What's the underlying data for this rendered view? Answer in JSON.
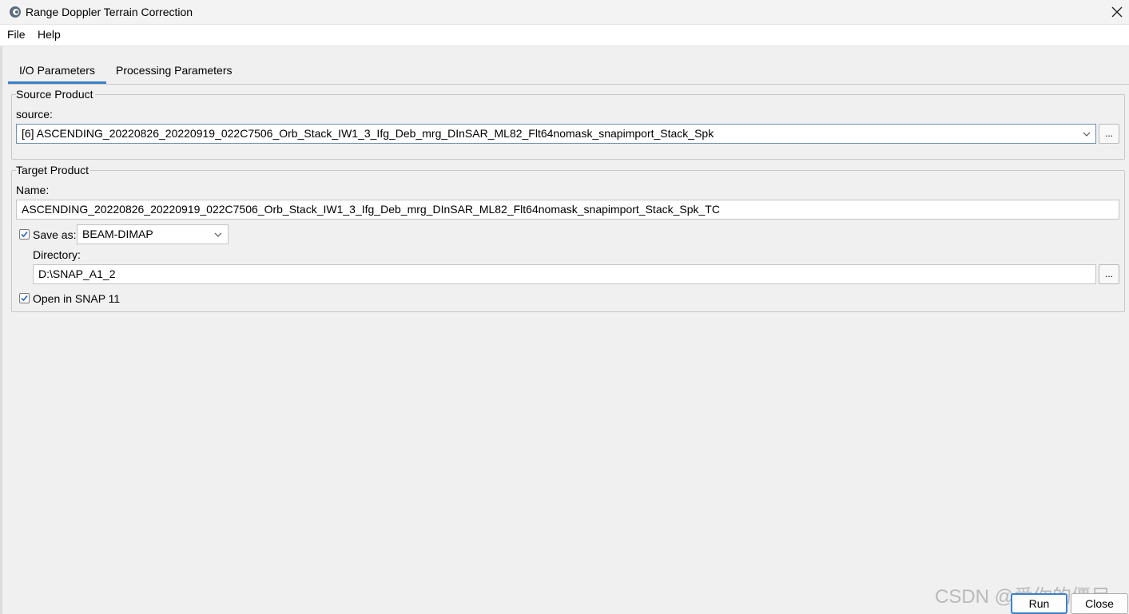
{
  "window": {
    "title": "Range Doppler Terrain Correction",
    "app_icon": "snap-logo-icon",
    "close_icon": "close-icon"
  },
  "menu": {
    "file": "File",
    "help": "Help"
  },
  "tabs": {
    "io": "I/O Parameters",
    "processing": "Processing Parameters",
    "selected": "I/O Parameters"
  },
  "source_product": {
    "group_label": "Source Product",
    "source_label": "source:",
    "source_value": "[6] ASCENDING_20220826_20220919_022C7506_Orb_Stack_IW1_3_Ifg_Deb_mrg_DInSAR_ML82_Flt64nomask_snapimport_Stack_Spk",
    "browse_label": "..."
  },
  "target_product": {
    "group_label": "Target Product",
    "name_label": "Name:",
    "name_value": "ASCENDING_20220826_20220919_022C7506_Orb_Stack_IW1_3_Ifg_Deb_mrg_DInSAR_ML82_Flt64nomask_snapimport_Stack_Spk_TC",
    "save_as_label": "Save as:",
    "save_as_checked": true,
    "format_value": "BEAM-DIMAP",
    "directory_label": "Directory:",
    "directory_value": "D:\\SNAP_A1_2",
    "browse_label": "...",
    "open_in_snap_label": "Open in SNAP 11",
    "open_in_snap_checked": true
  },
  "buttons": {
    "run": "Run",
    "close": "Close"
  },
  "watermark": "CSDN @爱你的僵尸",
  "colors": {
    "accent": "#3c7fc7",
    "background": "#f0f0f0"
  }
}
